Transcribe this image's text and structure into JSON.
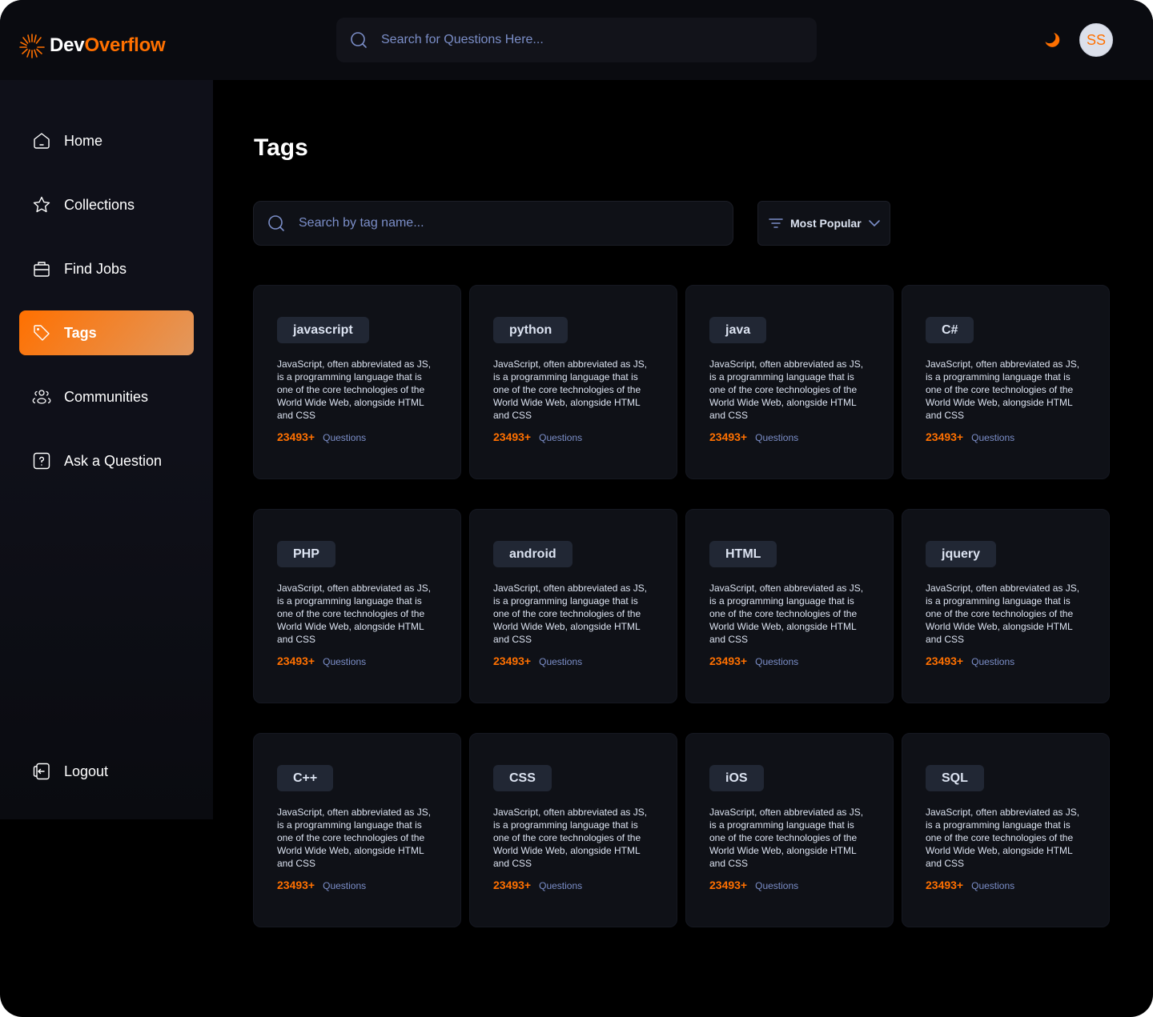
{
  "app": {
    "logo_prefix": "Dev",
    "logo_suffix": "Overflow",
    "brand_color": "#ff7000"
  },
  "header": {
    "search_placeholder": "Search for Questions Here...",
    "theme_icon": "moon-icon",
    "avatar_initials": "SS"
  },
  "sidebar": {
    "items": [
      {
        "label": "Home",
        "icon": "home-icon",
        "active": false
      },
      {
        "label": "Collections",
        "icon": "star-icon",
        "active": false
      },
      {
        "label": "Find Jobs",
        "icon": "briefcase-icon",
        "active": false
      },
      {
        "label": "Tags",
        "icon": "tag-icon",
        "active": true
      },
      {
        "label": "Communities",
        "icon": "users-icon",
        "active": false
      },
      {
        "label": "Ask a Question",
        "icon": "question-icon",
        "active": false
      }
    ],
    "logout_label": "Logout"
  },
  "main": {
    "title": "Tags",
    "search_placeholder": "Search by tag name...",
    "filter": {
      "selected": "Most Popular"
    },
    "tags": [
      {
        "name": "javascript",
        "description": "JavaScript, often abbreviated as JS, is a programming language that is one of the core technologies of the World Wide Web, alongside HTML and CSS",
        "count": "23493+",
        "count_label": "Questions"
      },
      {
        "name": "python",
        "description": "JavaScript, often abbreviated as JS, is a programming language that is one of the core technologies of the World Wide Web, alongside HTML and CSS",
        "count": "23493+",
        "count_label": "Questions"
      },
      {
        "name": "java",
        "description": "JavaScript, often abbreviated as JS, is a programming language that is one of the core technologies of the World Wide Web, alongside HTML and CSS",
        "count": "23493+",
        "count_label": "Questions"
      },
      {
        "name": "C#",
        "description": "JavaScript, often abbreviated as JS, is a programming language that is one of the core technologies of the World Wide Web, alongside HTML and CSS",
        "count": "23493+",
        "count_label": "Questions"
      },
      {
        "name": "PHP",
        "description": "JavaScript, often abbreviated as JS, is a programming language that is one of the core technologies of the World Wide Web, alongside HTML and CSS",
        "count": "23493+",
        "count_label": "Questions"
      },
      {
        "name": "android",
        "description": "JavaScript, often abbreviated as JS, is a programming language that is one of the core technologies of the World Wide Web, alongside HTML and CSS",
        "count": "23493+",
        "count_label": "Questions"
      },
      {
        "name": "HTML",
        "description": "JavaScript, often abbreviated as JS, is a programming language that is one of the core technologies of the World Wide Web, alongside HTML and CSS",
        "count": "23493+",
        "count_label": "Questions"
      },
      {
        "name": "jquery",
        "description": "JavaScript, often abbreviated as JS, is a programming language that is one of the core technologies of the World Wide Web, alongside HTML and CSS",
        "count": "23493+",
        "count_label": "Questions"
      },
      {
        "name": "C++",
        "description": "JavaScript, often abbreviated as JS, is a programming language that is one of the core technologies of the World Wide Web, alongside HTML and CSS",
        "count": "23493+",
        "count_label": "Questions"
      },
      {
        "name": "CSS",
        "description": "JavaScript, often abbreviated as JS, is a programming language that is one of the core technologies of the World Wide Web, alongside HTML and CSS",
        "count": "23493+",
        "count_label": "Questions"
      },
      {
        "name": "iOS",
        "description": "JavaScript, often abbreviated as JS, is a programming language that is one of the core technologies of the World Wide Web, alongside HTML and CSS",
        "count": "23493+",
        "count_label": "Questions"
      },
      {
        "name": "SQL",
        "description": "JavaScript, often abbreviated as JS, is a programming language that is one of the core technologies of the World Wide Web, alongside HTML and CSS",
        "count": "23493+",
        "count_label": "Questions"
      }
    ]
  }
}
